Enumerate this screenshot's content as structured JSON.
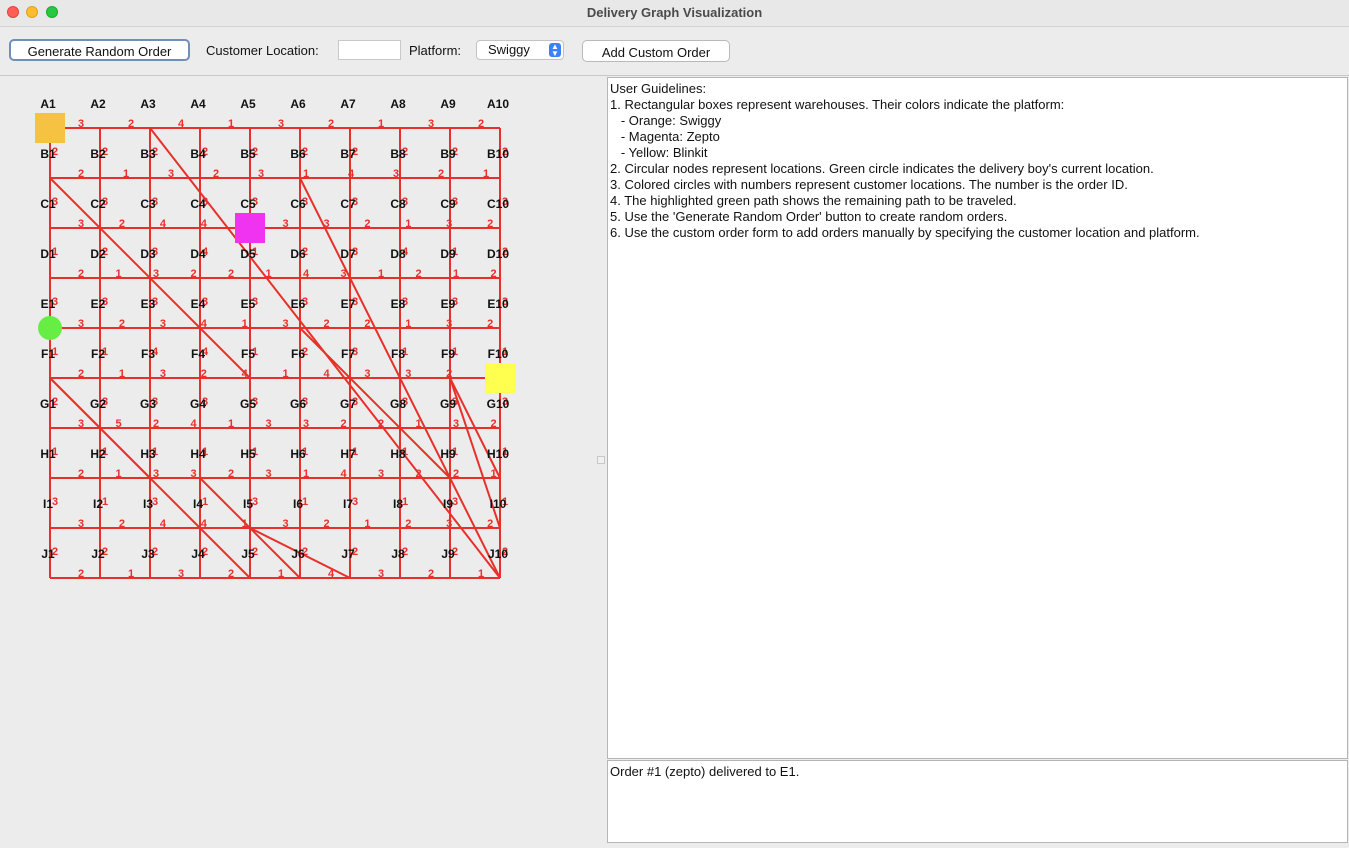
{
  "window": {
    "title": "Delivery Graph Visualization"
  },
  "toolbar": {
    "generate_label": "Generate Random Order",
    "customer_location_label": "Customer Location:",
    "customer_location_value": "",
    "platform_label": "Platform:",
    "platform_selected": "Swiggy",
    "add_custom_label": "Add Custom Order"
  },
  "graph": {
    "rows": [
      "A",
      "B",
      "C",
      "D",
      "E",
      "F",
      "G",
      "H",
      "I",
      "J"
    ],
    "cols": [
      "1",
      "2",
      "3",
      "4",
      "5",
      "6",
      "7",
      "8",
      "9",
      "10"
    ],
    "h_weights": [
      [
        3,
        2,
        4,
        1,
        3,
        2,
        1,
        3,
        2
      ],
      [
        2,
        1,
        3,
        2,
        3,
        1,
        4,
        3,
        2,
        1
      ],
      [
        3,
        2,
        4,
        4,
        1,
        3,
        3,
        2,
        1,
        3,
        2
      ],
      [
        2,
        1,
        3,
        2,
        2,
        1,
        4,
        3,
        1,
        2,
        1,
        2
      ],
      [
        3,
        2,
        3,
        4,
        1,
        3,
        2,
        2,
        1,
        3,
        2
      ],
      [
        2,
        1,
        3,
        2,
        4,
        1,
        4,
        3,
        3,
        2,
        1
      ],
      [
        3,
        5,
        2,
        4,
        1,
        3,
        3,
        2,
        2,
        1,
        3,
        2
      ],
      [
        2,
        1,
        3,
        3,
        2,
        3,
        1,
        4,
        3,
        2,
        2,
        1
      ],
      [
        3,
        2,
        4,
        4,
        1,
        3,
        2,
        1,
        2,
        3,
        2
      ],
      [
        2,
        1,
        3,
        2,
        1,
        4,
        3,
        2,
        1
      ]
    ],
    "v_weights": [
      [
        2,
        2,
        2,
        2,
        2,
        2,
        2,
        2,
        2,
        2
      ],
      [
        3,
        3,
        3,
        3,
        3,
        3,
        3,
        3,
        3,
        3
      ],
      [
        1,
        2,
        3,
        4,
        1,
        2,
        3,
        4,
        1,
        2
      ],
      [
        3,
        3,
        3,
        3,
        3,
        3,
        3,
        3,
        3,
        3
      ],
      [
        1,
        1,
        4,
        4,
        1,
        2,
        3,
        1,
        1,
        1
      ],
      [
        2,
        3,
        3,
        3,
        3,
        3,
        3,
        3,
        3,
        3
      ],
      [
        1,
        1,
        1,
        1,
        1,
        1,
        1,
        1,
        1,
        1
      ],
      [
        3,
        1,
        3,
        1,
        3,
        1,
        3,
        1,
        3,
        1
      ],
      [
        2,
        2,
        2,
        2,
        2,
        2,
        2,
        2,
        2,
        2
      ]
    ],
    "warehouses": [
      {
        "platform": "Swiggy",
        "color": "#f5c242",
        "node": "A1"
      },
      {
        "platform": "Zepto",
        "color": "#f033f0",
        "node": "C5"
      },
      {
        "platform": "Blinkit",
        "color": "#ffff50",
        "node": "F10"
      }
    ],
    "delivery_boy": {
      "node": "E1",
      "color": "#66ee44"
    },
    "edge_color": "#e8302a"
  },
  "guidelines": [
    "User Guidelines:",
    "1. Rectangular boxes represent warehouses. Their colors indicate the platform:",
    "   - Orange: Swiggy",
    "   - Magenta: Zepto",
    "   - Yellow: Blinkit",
    "2. Circular nodes represent locations. Green circle indicates the delivery boy's current location.",
    "3. Colored circles with numbers represent customer locations. The number is the order ID.",
    "4. The highlighted green path shows the remaining path to be traveled.",
    "5. Use the 'Generate Random Order' button to create random orders.",
    "6. Use the custom order form to add orders manually by specifying the customer location and platform."
  ],
  "log": [
    "Order #1 (zepto) delivered to E1."
  ]
}
